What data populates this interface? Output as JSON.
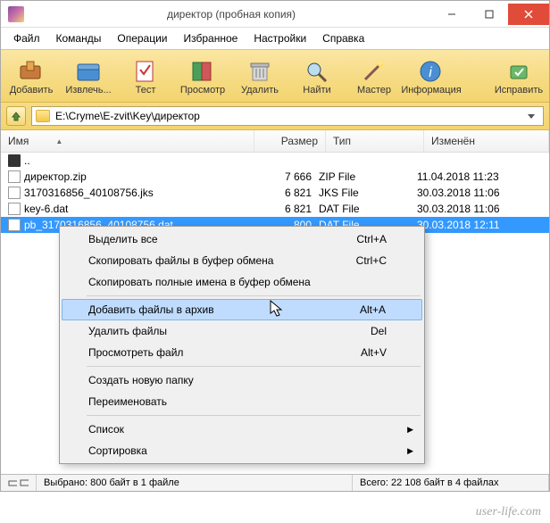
{
  "title": "директор (пробная копия)",
  "menu": [
    "Файл",
    "Команды",
    "Операции",
    "Избранное",
    "Настройки",
    "Справка"
  ],
  "toolbar": [
    {
      "label": "Добавить",
      "icon": "add"
    },
    {
      "label": "Извлечь...",
      "icon": "extract"
    },
    {
      "label": "Тест",
      "icon": "test"
    },
    {
      "label": "Просмотр",
      "icon": "view"
    },
    {
      "label": "Удалить",
      "icon": "delete"
    },
    {
      "label": "Найти",
      "icon": "find"
    },
    {
      "label": "Мастер",
      "icon": "wizard"
    },
    {
      "label": "Информация",
      "icon": "info"
    },
    {
      "label": "Исправить",
      "icon": "repair"
    }
  ],
  "path": "E:\\Cryme\\E-zvit\\Key\\директор",
  "columns": {
    "name": "Имя",
    "size": "Размер",
    "type": "Тип",
    "date": "Изменён"
  },
  "rows": [
    {
      "name": "..",
      "size": "",
      "type": "",
      "date": "",
      "icon": "up"
    },
    {
      "name": "директор.zip",
      "size": "7 666",
      "type": "ZIP File",
      "date": "11.04.2018 11:23",
      "icon": "doc"
    },
    {
      "name": "3170316856_40108756.jks",
      "size": "6 821",
      "type": "JKS File",
      "date": "30.03.2018 11:06",
      "icon": "doc"
    },
    {
      "name": "key-6.dat",
      "size": "6 821",
      "type": "DAT File",
      "date": "30.03.2018 11:06",
      "icon": "doc"
    },
    {
      "name": "pb_3170316856_40108756.dat",
      "size": "800",
      "type": "DAT File",
      "date": "30.03.2018 12:11",
      "icon": "doc",
      "selected": true
    }
  ],
  "status": {
    "selected": "Выбрано: 800 байт в 1 файле",
    "total": "Всего: 22 108 байт в 4 файлах"
  },
  "ctx": [
    {
      "t": "Выделить все",
      "s": "Ctrl+A"
    },
    {
      "t": "Скопировать файлы в буфер обмена",
      "s": "Ctrl+C"
    },
    {
      "t": "Скопировать полные имена в буфер обмена"
    },
    {
      "sep": true
    },
    {
      "t": "Добавить файлы в архив",
      "s": "Alt+A",
      "hl": true
    },
    {
      "t": "Удалить файлы",
      "s": "Del"
    },
    {
      "t": "Просмотреть файл",
      "s": "Alt+V"
    },
    {
      "sep": true
    },
    {
      "t": "Создать новую папку"
    },
    {
      "t": "Переименовать"
    },
    {
      "sep": true
    },
    {
      "t": "Список",
      "sub": true
    },
    {
      "t": "Сортировка",
      "sub": true
    }
  ],
  "watermark": "user-life.com"
}
